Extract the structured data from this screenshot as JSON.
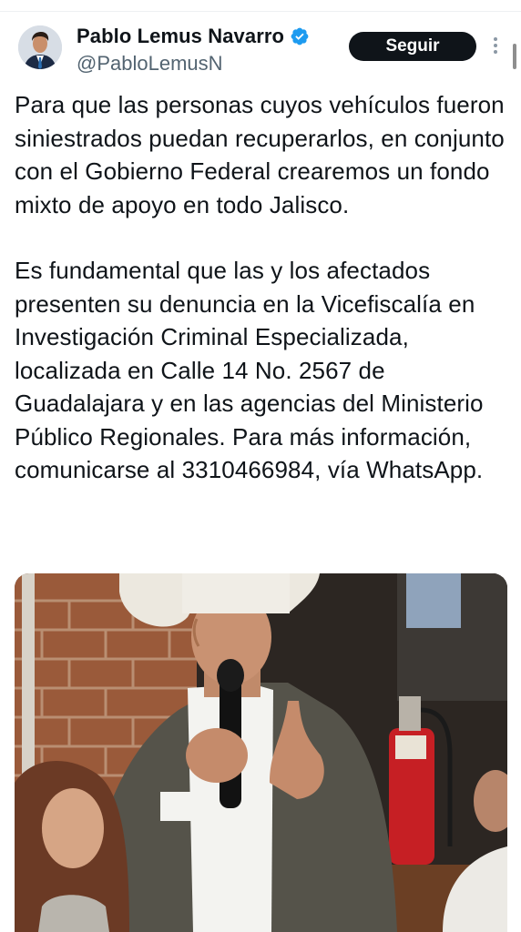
{
  "author": {
    "name": "Pablo Lemus Navarro",
    "handle": "@PabloLemusN",
    "verified": true
  },
  "actions": {
    "follow_label": "Seguir"
  },
  "tweet": {
    "paragraphs": [
      "Para que las personas cuyos vehículos fueron siniestrados puedan recuperarlos, en conjunto con el Gobierno Federal crearemos un fondo mixto de apoyo en todo Jalisco.",
      "Es fundamental que las y los afectados presenten su denuncia en la Vicefiscalía en Investigación Criminal Especializada, localizada en Calle 14 No. 2567 de Guadalajara y en las agencias del Ministerio Público Regionales. Para más información, comunicarse al 3310466984, vía WhatsApp."
    ]
  },
  "icons": {
    "verified": "verified-badge-icon",
    "more": "more-vertical-icon"
  },
  "colors": {
    "text": "#0f1419",
    "secondary": "#536471",
    "verified": "#1d9bf0",
    "button_bg": "#0f1419"
  }
}
